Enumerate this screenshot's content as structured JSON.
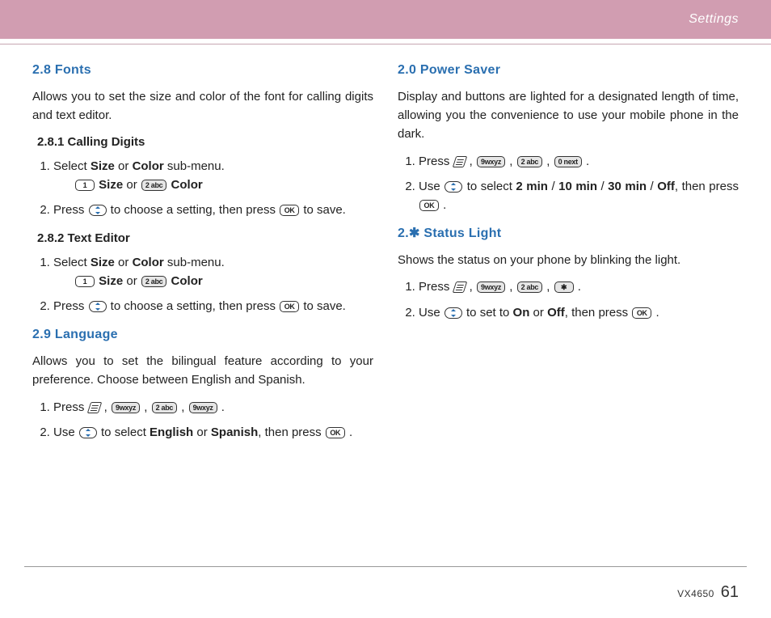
{
  "header": {
    "title": "Settings"
  },
  "footer": {
    "model": "VX4650",
    "page": "61"
  },
  "keys": {
    "ok": "OK",
    "k1": "1",
    "k2": "2 abc",
    "k9": "9wxyz",
    "k0": "0 next",
    "kstar": "✱"
  },
  "left": {
    "s28": {
      "title": "2.8 Fonts",
      "intro": "Allows you to set the size and color of the font for calling digits and text editor.",
      "s281": {
        "title": "2.8.1 Calling Digits",
        "step1a": "Select ",
        "step1b": " or ",
        "step1c": " sub-menu.",
        "size": "Size",
        "color": "Color",
        "opt_size": " Size ",
        "opt_or": "or ",
        "opt_color": " Color",
        "step2a": "Press ",
        "step2b": " to choose a setting, then press ",
        "step2c": " to save."
      },
      "s282": {
        "title": "2.8.2 Text Editor",
        "step1a": "Select ",
        "step1b": " or ",
        "step1c": " sub-menu.",
        "size": "Size",
        "color": "Color",
        "opt_size": " Size ",
        "opt_or": "or ",
        "opt_color": " Color",
        "step2a": "Press ",
        "step2b": " to choose a setting, then press ",
        "step2c": " to save."
      }
    },
    "s29": {
      "title": "2.9 Language",
      "intro": "Allows you to set the bilingual feature according to your preference. Choose between English and Spanish.",
      "step1a": " Press ",
      "comma": " , ",
      "period": " .",
      "step2a": "Use ",
      "step2b": " to select ",
      "english": "English",
      "or": " or ",
      "spanish": "Spanish",
      "step2c": ", then press ",
      "step2d": " ."
    }
  },
  "right": {
    "s20": {
      "title": "2.0 Power Saver",
      "intro": "Display and buttons are lighted for a designated length of time, allowing you the convenience to use your mobile phone in the dark.",
      "step1a": "Press ",
      "comma": " , ",
      "period": " .",
      "step2a": "Use ",
      "step2b": " to select ",
      "v1": "2 min",
      "sep": " / ",
      "v2": "10 min",
      "v3": "30 min",
      "v4": "Off",
      "step2c": ", then press ",
      "step2d": " ."
    },
    "sStar": {
      "title": "2.✱ Status Light",
      "intro": "Shows the status on your phone by blinking the light.",
      "step1a": "Press ",
      "comma": " , ",
      "period": " .",
      "step2a": "Use ",
      "step2b": " to set to ",
      "on": "On",
      "or": " or ",
      "off": "Off",
      "step2c": ", then press ",
      "step2d": " ."
    }
  }
}
